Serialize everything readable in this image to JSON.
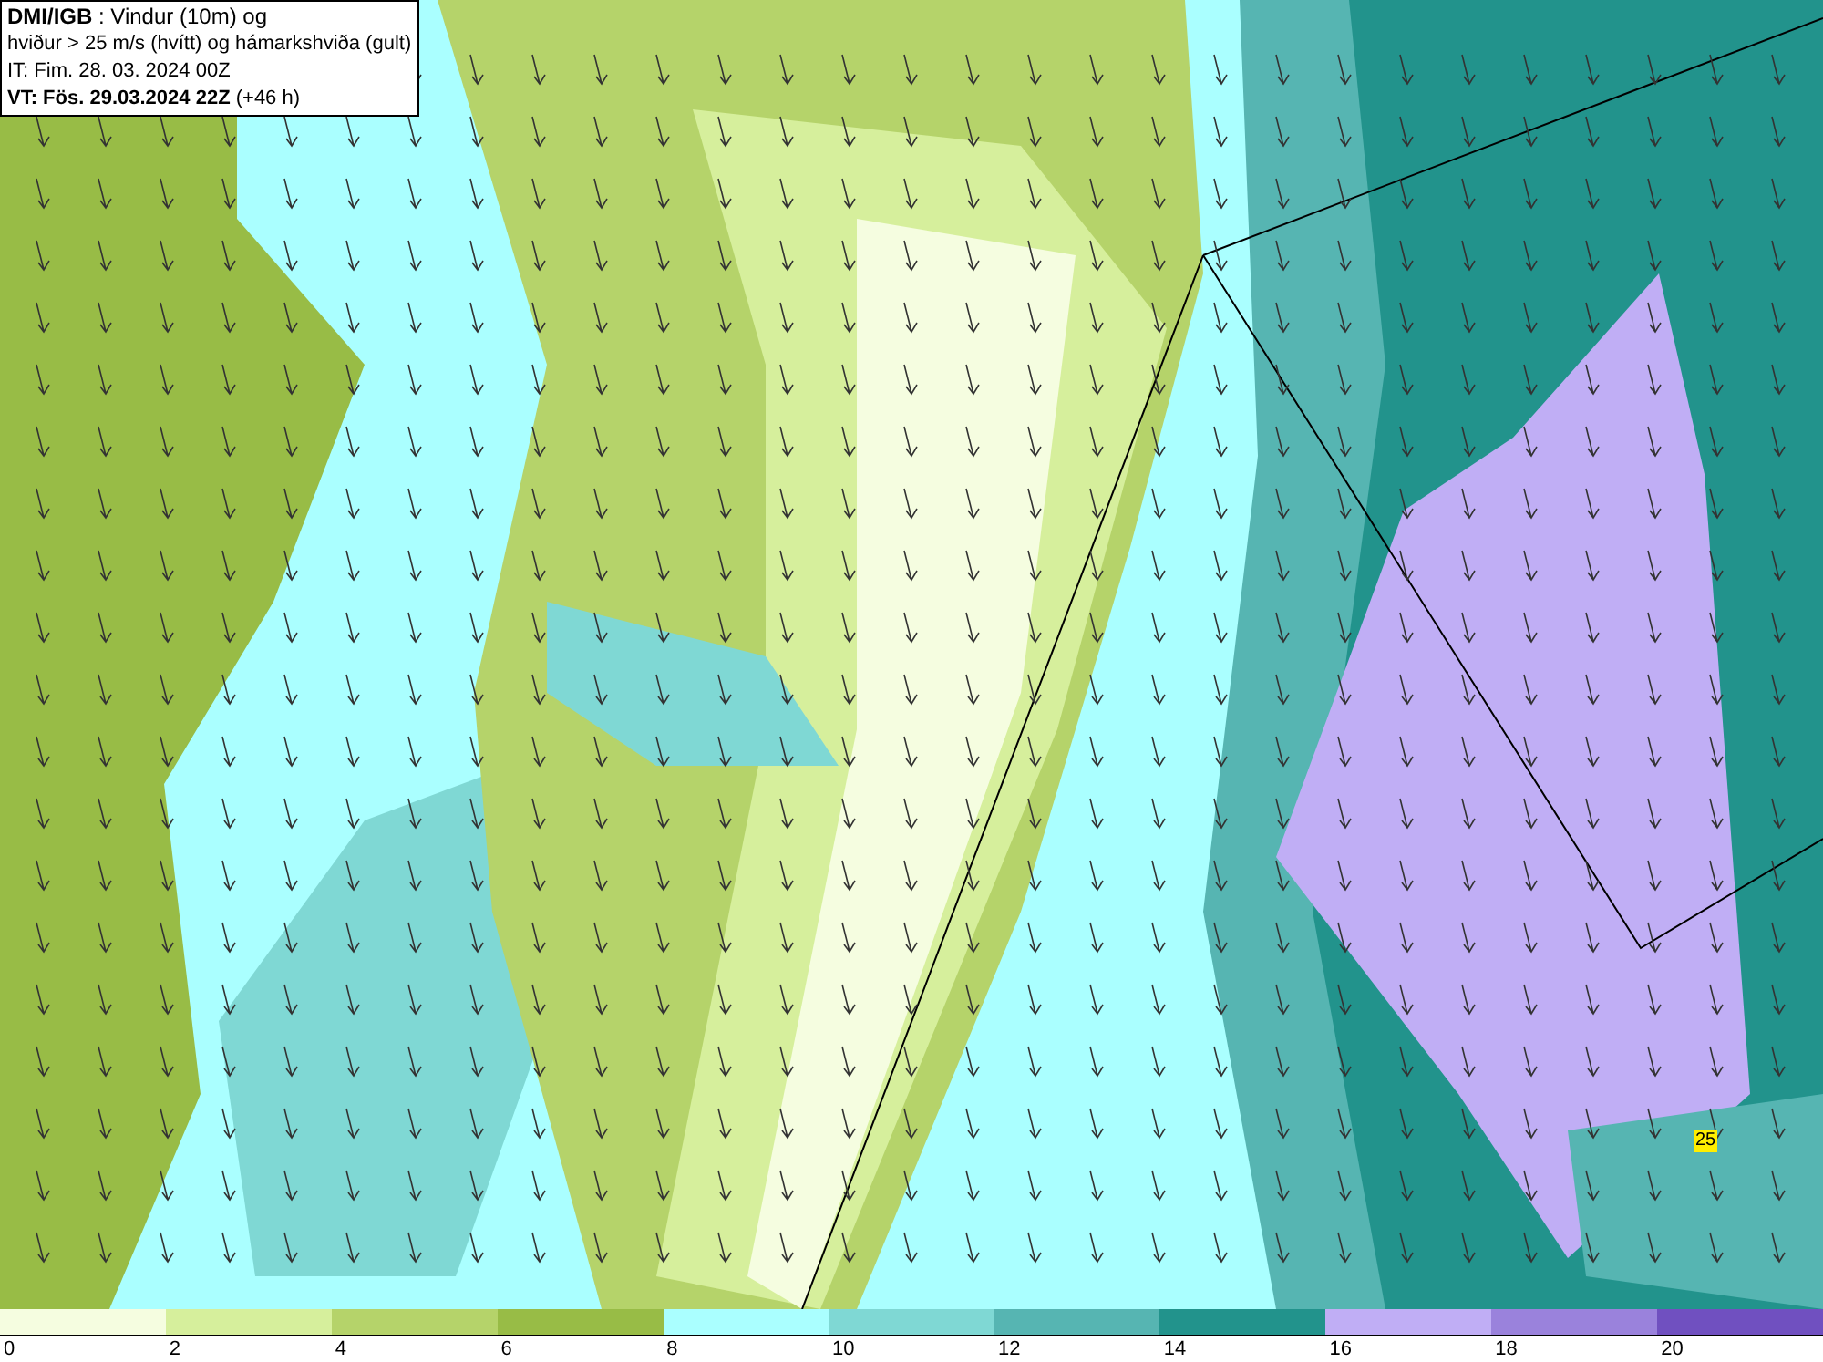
{
  "title_box": {
    "lines": [
      "**DMI/IGB** : Vindur (10m) og",
      "hviður > 25 m/s (hvítt) og hámarkshviða (gult)",
      "IT: Fim. 28. 03. 2024 00Z",
      "**VT: Fös. 29.03.2024 22Z** (+46 h)"
    ]
  },
  "map": {
    "gust_marker": "25"
  },
  "legend": {
    "segments": [
      {
        "color": "#f5fde0"
      },
      {
        "color": "#d6ef9c"
      },
      {
        "color": "#b5d36a"
      },
      {
        "color": "#98bc46"
      },
      {
        "color": "#aaffff"
      },
      {
        "color": "#7fd8d4"
      },
      {
        "color": "#56b5b2"
      },
      {
        "color": "#22938c"
      },
      {
        "color": "#c0aef5"
      },
      {
        "color": "#9a82dc"
      },
      {
        "color": "#7050c0"
      }
    ],
    "labels": [
      "0",
      "2",
      "4",
      "6",
      "8",
      "10",
      "12",
      "14",
      "16",
      "18",
      "20"
    ]
  }
}
